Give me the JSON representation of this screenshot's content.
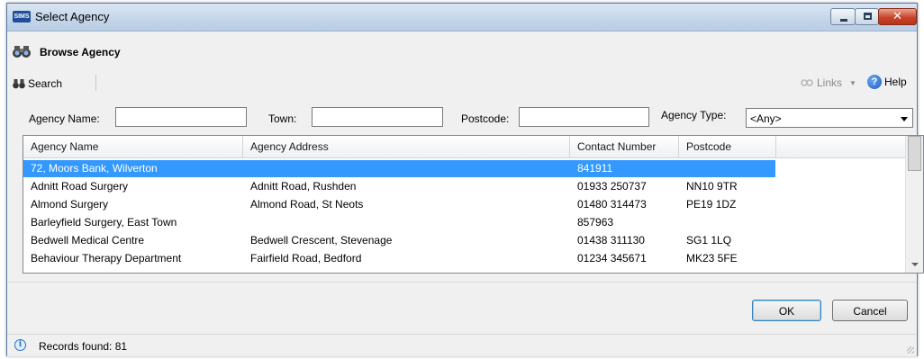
{
  "window": {
    "title": "Select Agency",
    "app_icon_text": "SIMS"
  },
  "browse": {
    "title": "Browse Agency"
  },
  "toolbar": {
    "search_label": "Search",
    "links_label": "Links",
    "help_label": "Help"
  },
  "filters": {
    "agency_name_label": "Agency Name:",
    "agency_name_value": "",
    "town_label": "Town:",
    "town_value": "",
    "postcode_label": "Postcode:",
    "postcode_value": "",
    "agency_type_label": "Agency Type:",
    "agency_type_value": "<Any>"
  },
  "table": {
    "columns": [
      "Agency Name",
      "Agency Address",
      "Contact Number",
      "Postcode"
    ],
    "rows": [
      {
        "name": "72, Moors Bank, Wilverton",
        "address": "",
        "contact": "841911",
        "postcode": "",
        "selected": true
      },
      {
        "name": "Adnitt Road Surgery",
        "address": "Adnitt Road, Rushden",
        "contact": "01933 250737",
        "postcode": "NN10 9TR"
      },
      {
        "name": "Almond Surgery",
        "address": "Almond Road, St Neots",
        "contact": "01480 314473",
        "postcode": "PE19 1DZ"
      },
      {
        "name": "Barleyfield Surgery, East Town",
        "address": "",
        "contact": "857963",
        "postcode": ""
      },
      {
        "name": "Bedwell Medical Centre",
        "address": "Bedwell Crescent, Stevenage",
        "contact": "01438 311130",
        "postcode": "SG1 1LQ"
      },
      {
        "name": "Behaviour Therapy Department",
        "address": "Fairfield Road, Bedford",
        "contact": "01234 345671",
        "postcode": "MK23 5FE"
      }
    ]
  },
  "buttons": {
    "ok": "OK",
    "cancel": "Cancel"
  },
  "status": {
    "text": "Records found: 81"
  },
  "colors": {
    "selection": "#3399ff",
    "titlebar": "#c5d6ea",
    "close_button": "#c8452c"
  }
}
